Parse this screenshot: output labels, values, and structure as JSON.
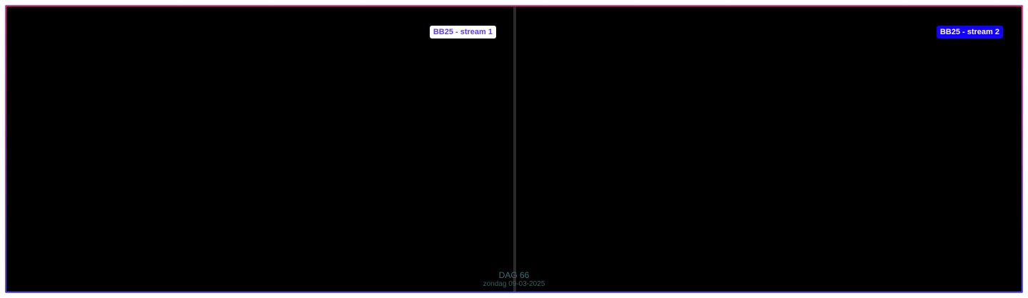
{
  "streams": [
    {
      "label": "BB25 - stream 1"
    },
    {
      "label": "BB25 - stream 2"
    }
  ],
  "footer": {
    "day": "DAG 66",
    "date": "zondag 09-03-2025"
  },
  "colors": {
    "frame_top": "#ff2d95",
    "frame_bottom": "#5a4bff",
    "label_1_bg": "#ffffff",
    "label_1_text": "#5a3cff",
    "label_2_bg": "#1400ff",
    "label_2_text": "#ffffff"
  }
}
